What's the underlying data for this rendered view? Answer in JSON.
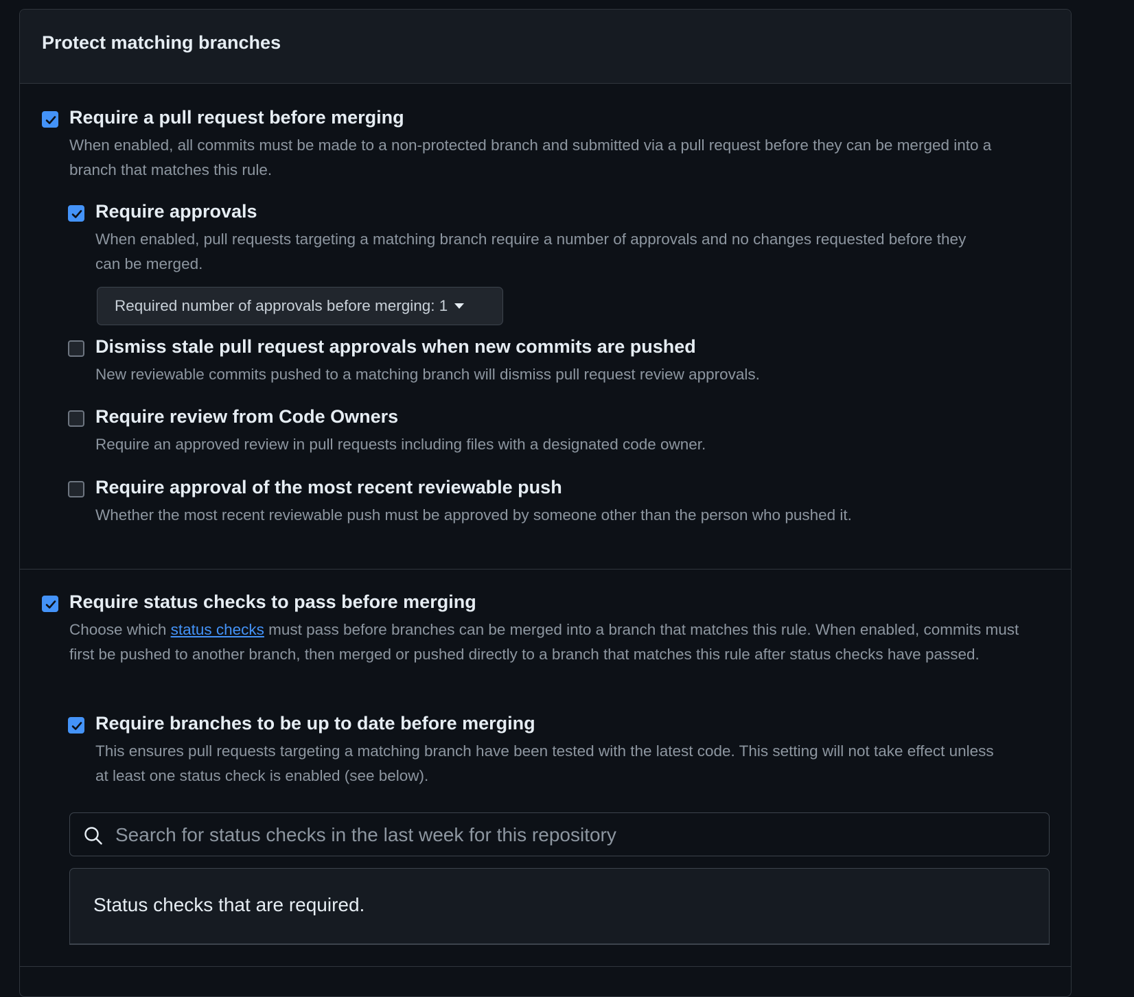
{
  "header": {
    "title": "Protect matching branches"
  },
  "options": {
    "require_pr": {
      "checked": true,
      "label": "Require a pull request before merging",
      "description": "When enabled, all commits must be made to a non-protected branch and submitted via a pull request before they can be merged into a branch that matches this rule."
    },
    "require_approvals": {
      "checked": true,
      "label": "Require approvals",
      "description": "When enabled, pull requests targeting a matching branch require a number of approvals and no changes requested before they can be merged.",
      "dropdown_label": "Required number of approvals before merging: 1"
    },
    "dismiss_stale": {
      "checked": false,
      "label": "Dismiss stale pull request approvals when new commits are pushed",
      "description": "New reviewable commits pushed to a matching branch will dismiss pull request review approvals."
    },
    "code_owners": {
      "checked": false,
      "label": "Require review from Code Owners",
      "description": "Require an approved review in pull requests including files with a designated code owner."
    },
    "recent_push": {
      "checked": false,
      "label": "Require approval of the most recent reviewable push",
      "description": "Whether the most recent reviewable push must be approved by someone other than the person who pushed it."
    },
    "status_checks": {
      "checked": true,
      "label": "Require status checks to pass before merging",
      "description_before": "Choose which ",
      "description_link": "status checks",
      "description_after": " must pass before branches can be merged into a branch that matches this rule. When enabled, commits must first be pushed to another branch, then merged or pushed directly to a branch that matches this rule after status checks have passed."
    },
    "up_to_date": {
      "checked": true,
      "label": "Require branches to be up to date before merging",
      "description": "This ensures pull requests targeting a matching branch have been tested with the latest code. This setting will not take effect unless at least one status check is enabled (see below)."
    }
  },
  "search": {
    "placeholder": "Search for status checks in the last week for this repository",
    "value": ""
  },
  "required_checks": {
    "title": "Status checks that are required."
  },
  "colors": {
    "accent": "#4493f8",
    "background": "#0d1117",
    "header_bg": "#161b22",
    "border": "#30363d",
    "muted_text": "#8d96a0"
  }
}
